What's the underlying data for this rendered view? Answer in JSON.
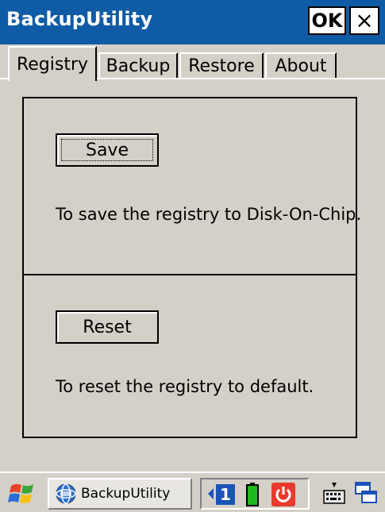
{
  "window": {
    "title": "BackupUtility",
    "ok_label": "OK",
    "close_label": "×"
  },
  "tabs": [
    {
      "label": "Registry",
      "active": true
    },
    {
      "label": "Backup",
      "active": false
    },
    {
      "label": "Restore",
      "active": false
    },
    {
      "label": "About",
      "active": false
    }
  ],
  "registry": {
    "save_label": "Save",
    "save_desc": "To save the registry to Disk-On-Chip.",
    "reset_label": "Reset",
    "reset_desc": "To reset the registry to default."
  },
  "taskbar": {
    "task_label": "BackupUtility",
    "tray_number": "1",
    "icons": [
      "windows-start-icon",
      "app-globe-icon",
      "arrow-left-icon",
      "battery-icon",
      "power-icon",
      "keyboard-icon",
      "window-switch-icon"
    ]
  },
  "colors": {
    "titlebar": "#0f5ba6",
    "background": "#d4d0c8",
    "tray_number_bg": "#1b53b8",
    "battery": "#1fb81f",
    "power": "#e83a2d"
  }
}
